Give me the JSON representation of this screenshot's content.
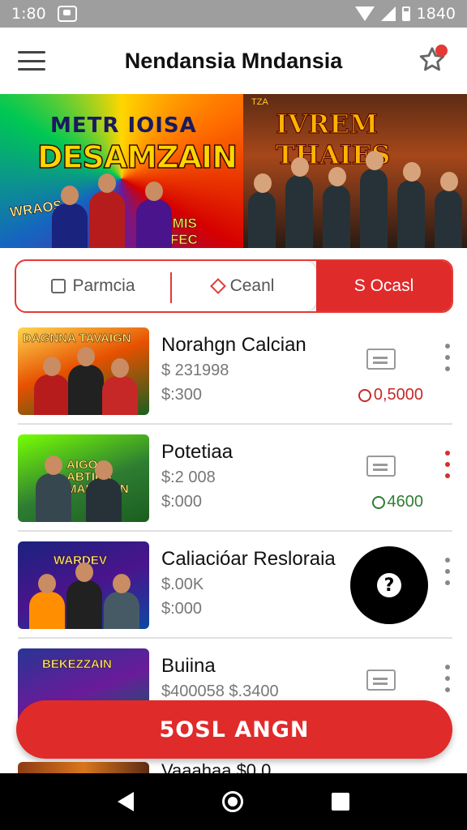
{
  "status_bar": {
    "time": "1:80",
    "battery_text": "1840"
  },
  "app_bar": {
    "title": "Nendansia Mndansia"
  },
  "banner": {
    "left_title_1": "METR    IOISA",
    "left_title_2": "DESAMZAIN",
    "left_sub_1": "WRAOS",
    "left_sub_2": "SEMIS FIIFEC",
    "right_tag": "TZA",
    "right_title": "IVREM THAIES"
  },
  "tabs": [
    {
      "label": "Parmcia",
      "icon": "search-outline-icon"
    },
    {
      "label": "Ceanl",
      "icon": "diamond-icon"
    },
    {
      "label": "S Ocasl",
      "icon": ""
    }
  ],
  "list": [
    {
      "title": "Norahgn Calcian",
      "line1": "$ 231998",
      "line2": "$:300",
      "price": "0,5000",
      "price_color": "#c62828",
      "thumb_caption": "DAGNNA TAVAIGN",
      "menu_color": "grey"
    },
    {
      "title": "Potetiaa",
      "line1": "$:2 008",
      "line2": "$:000",
      "price": "4600",
      "price_color": "#2e7d32",
      "thumb_caption": "AIGO ABTIEN MAREANN",
      "menu_color": "red"
    },
    {
      "title": "Caliacióar Resloraia",
      "line1": "$.00K",
      "line2": "$:000",
      "price": "",
      "price_color": "#2e7d32",
      "thumb_caption": "WARDEV",
      "menu_color": "grey"
    },
    {
      "title": "Buiina",
      "line1": "$400058 $.3400",
      "line2": "",
      "price": "",
      "price_color": "#2e7d32",
      "thumb_caption": "BEKEZZAIN",
      "menu_color": "grey"
    }
  ],
  "partial_row": {
    "text": "Vaaahaa $0 0"
  },
  "action_button": {
    "label": "5OSL ANGN"
  },
  "help_fab": {
    "glyph": "?"
  },
  "colors": {
    "accent": "#e02b2b",
    "success": "#2e7d32"
  }
}
